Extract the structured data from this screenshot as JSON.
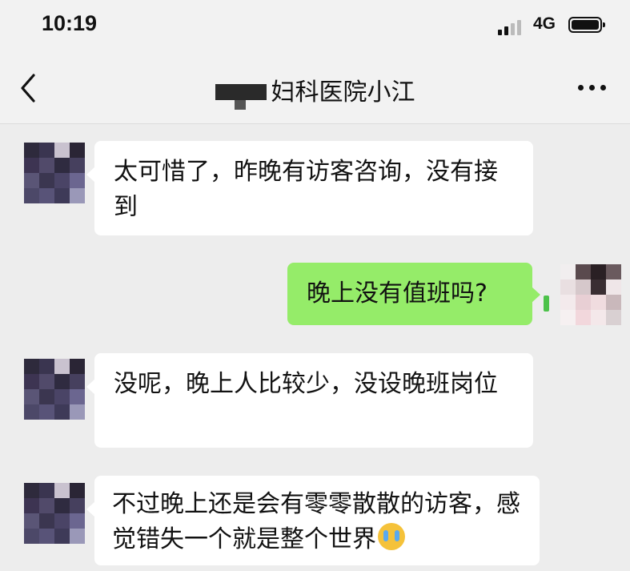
{
  "status_bar": {
    "time": "10:19",
    "network": "4G"
  },
  "nav": {
    "title": "妇科医院小江",
    "back_icon": "chevron-left-icon",
    "more_icon": "more-dots-icon"
  },
  "messages": [
    {
      "side": "left",
      "text": "太可惜了，昨晚有访客咨询，没有接到"
    },
    {
      "side": "right",
      "text": "晚上没有值班吗?"
    },
    {
      "side": "left",
      "text": "没呢，晚上人比较少，没设晚班岗位"
    },
    {
      "side": "left",
      "text": "不过晚上还是会有零零散散的访客，感觉错失一个就是整个世界",
      "emoji": "crying-face-emoji"
    }
  ],
  "colors": {
    "background": "#ededed",
    "bubble_self": "#95ec69",
    "bubble_other": "#ffffff"
  }
}
